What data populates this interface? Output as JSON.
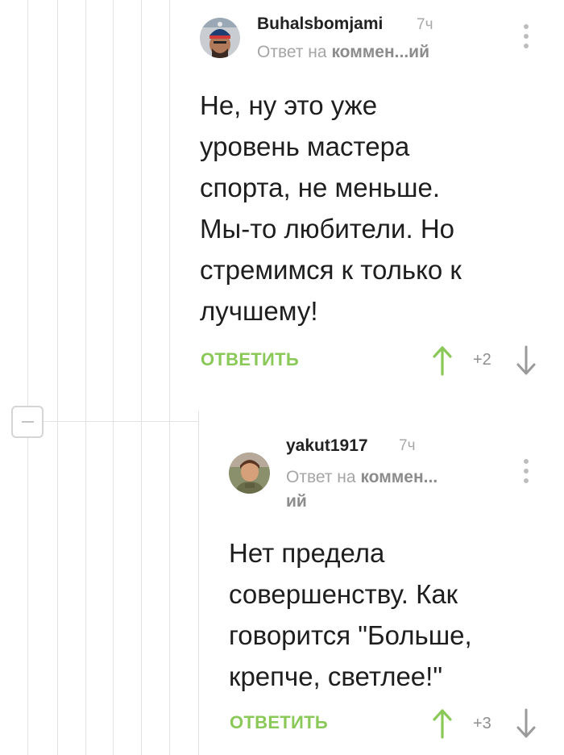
{
  "comments": [
    {
      "username": "Buhalsbomjami",
      "time": "7ч",
      "reply_prefix": "Ответ на",
      "reply_target": "коммен...ий",
      "text_lines": [
        "Не, ну это уже",
        "уровень мастера",
        "спорта, не меньше.",
        "Мы-то любители. Но",
        "стремимся к только к",
        "лучшему!"
      ],
      "reply_label": "ОТВЕТИТЬ",
      "score": "+2"
    },
    {
      "username": "yakut1917",
      "time": "7ч",
      "reply_prefix": "Ответ на",
      "reply_target": "коммен...",
      "reply_target_cont": "ий",
      "text_lines": [
        "Нет предела",
        "совершенству. Как",
        "говорится \"Больше,",
        "крепче, светлее!\""
      ],
      "reply_label": "ОТВЕТИТЬ",
      "score": "+3"
    }
  ],
  "colors": {
    "accent": "#8ac858",
    "muted_text": "#a5a5a5",
    "thread_line": "#e2e2e2"
  },
  "icons": {
    "collapse": "minus-icon",
    "menu": "kebab-icon",
    "upvote": "arrow-up-icon",
    "downvote": "arrow-down-icon"
  }
}
